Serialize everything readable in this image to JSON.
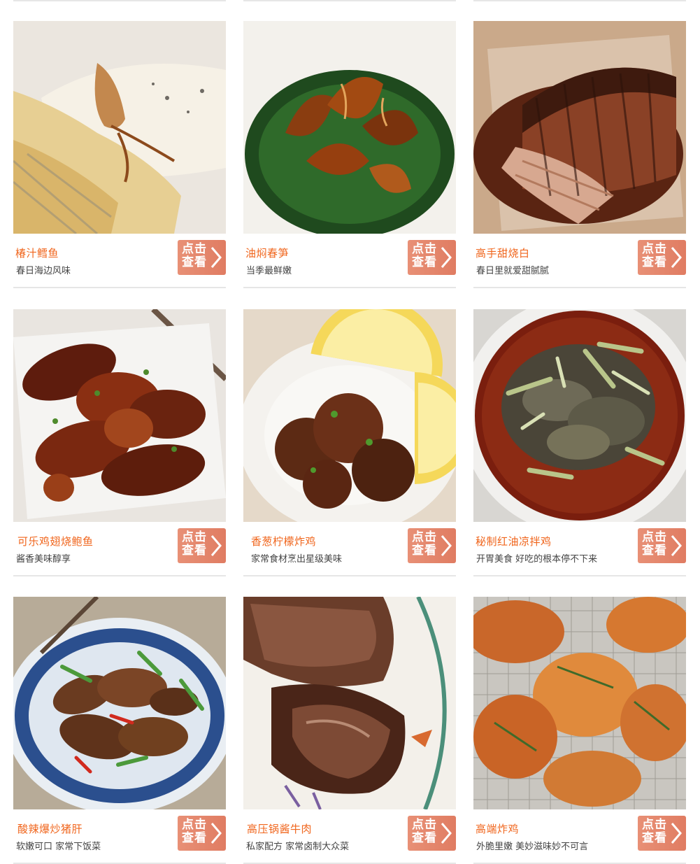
{
  "cards": [
    {
      "title": "椿汁鳕鱼",
      "subtitle": "春日海边风味",
      "button": "点击查看",
      "image": "cod-fish-photo"
    },
    {
      "title": "油焖春笋",
      "subtitle": "当季最鲜嫩",
      "button": "点击查看",
      "image": "braised-bamboo-shoots-photo"
    },
    {
      "title": "高手甜烧白",
      "subtitle": "春日里就爱甜腻腻",
      "button": "点击查看",
      "image": "sweet-pork-belly-photo"
    },
    {
      "title": "可乐鸡翅烧鲍鱼",
      "subtitle": "酱香美味醇享",
      "button": "点击查看",
      "image": "cola-wings-abalone-photo"
    },
    {
      "title": "香葱柠檬炸鸡",
      "subtitle": "家常食材烹出星级美味",
      "button": "点击查看",
      "image": "lemon-fried-chicken-photo"
    },
    {
      "title": "秘制红油凉拌鸡",
      "subtitle": "开胃美食 好吃的根本停不下来",
      "button": "点击查看",
      "image": "chili-oil-chicken-photo"
    },
    {
      "title": "酸辣爆炒猪肝",
      "subtitle": "软嫩可口 家常下饭菜",
      "button": "点击查看",
      "image": "spicy-pork-liver-photo"
    },
    {
      "title": "高压锅酱牛肉",
      "subtitle": "私家配方 家常卤制大众菜",
      "button": "点击查看",
      "image": "braised-beef-photo"
    },
    {
      "title": "高端炸鸡",
      "subtitle": "外脆里嫩 美妙滋味妙不可言",
      "button": "点击查看",
      "image": "fried-chicken-photo"
    }
  ],
  "colors": {
    "title": "#f0651c",
    "button": "#e4866c",
    "divider": "#e6e6e6"
  }
}
